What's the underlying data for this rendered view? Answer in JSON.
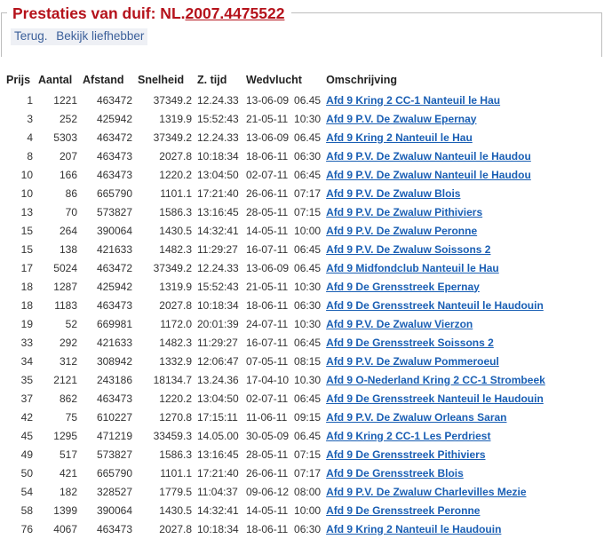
{
  "header": {
    "title_prefix": "Prestaties van duif: NL.",
    "title_number": "2007.4475522"
  },
  "nav": {
    "back_label": "Terug.",
    "owner_label": "Bekijk liefhebber"
  },
  "table": {
    "columns": [
      "Prijs",
      "Aantal",
      "Afstand",
      "Snelheid",
      "Z. tijd",
      "Wedvlucht",
      "Omschrijving"
    ],
    "rows": [
      {
        "prijs": "1",
        "aantal": "1221",
        "afstand": "463472",
        "snelheid": "37349.2",
        "ztijd": "12.24.33",
        "datum": "13-06-09",
        "tijd": "06.45",
        "oms": "Afd 9 Kring 2 CC-1 Nanteuil le Hau"
      },
      {
        "prijs": "3",
        "aantal": "252",
        "afstand": "425942",
        "snelheid": "1319.9",
        "ztijd": "15:52:43",
        "datum": "21-05-11",
        "tijd": "10:30",
        "oms": "Afd 9 P.V. De Zwaluw Epernay"
      },
      {
        "prijs": "4",
        "aantal": "5303",
        "afstand": "463472",
        "snelheid": "37349.2",
        "ztijd": "12.24.33",
        "datum": "13-06-09",
        "tijd": "06.45",
        "oms": "Afd 9 Kring 2 Nanteuil le Hau"
      },
      {
        "prijs": "8",
        "aantal": "207",
        "afstand": "463473",
        "snelheid": "2027.8",
        "ztijd": "10:18:34",
        "datum": "18-06-11",
        "tijd": "06:30",
        "oms": "Afd 9 P.V. De Zwaluw Nanteuil le Haudou"
      },
      {
        "prijs": "10",
        "aantal": "166",
        "afstand": "463473",
        "snelheid": "1220.2",
        "ztijd": "13:04:50",
        "datum": "02-07-11",
        "tijd": "06:45",
        "oms": "Afd 9 P.V. De Zwaluw Nanteuil le Haudou"
      },
      {
        "prijs": "10",
        "aantal": "86",
        "afstand": "665790",
        "snelheid": "1101.1",
        "ztijd": "17:21:40",
        "datum": "26-06-11",
        "tijd": "07:17",
        "oms": "Afd 9 P.V. De Zwaluw Blois"
      },
      {
        "prijs": "13",
        "aantal": "70",
        "afstand": "573827",
        "snelheid": "1586.3",
        "ztijd": "13:16:45",
        "datum": "28-05-11",
        "tijd": "07:15",
        "oms": "Afd 9 P.V. De Zwaluw Pithiviers"
      },
      {
        "prijs": "15",
        "aantal": "264",
        "afstand": "390064",
        "snelheid": "1430.5",
        "ztijd": "14:32:41",
        "datum": "14-05-11",
        "tijd": "10:00",
        "oms": "Afd 9 P.V. De Zwaluw Peronne"
      },
      {
        "prijs": "15",
        "aantal": "138",
        "afstand": "421633",
        "snelheid": "1482.3",
        "ztijd": "11:29:27",
        "datum": "16-07-11",
        "tijd": "06:45",
        "oms": "Afd 9 P.V. De Zwaluw Soissons 2"
      },
      {
        "prijs": "17",
        "aantal": "5024",
        "afstand": "463472",
        "snelheid": "37349.2",
        "ztijd": "12.24.33",
        "datum": "13-06-09",
        "tijd": "06.45",
        "oms": "Afd 9 Midfondclub Nanteuil le Hau"
      },
      {
        "prijs": "18",
        "aantal": "1287",
        "afstand": "425942",
        "snelheid": "1319.9",
        "ztijd": "15:52:43",
        "datum": "21-05-11",
        "tijd": "10:30",
        "oms": "Afd 9 De Grensstreek Epernay"
      },
      {
        "prijs": "18",
        "aantal": "1183",
        "afstand": "463473",
        "snelheid": "2027.8",
        "ztijd": "10:18:34",
        "datum": "18-06-11",
        "tijd": "06:30",
        "oms": "Afd 9 De Grensstreek Nanteuil le Haudouin"
      },
      {
        "prijs": "19",
        "aantal": "52",
        "afstand": "669981",
        "snelheid": "1172.0",
        "ztijd": "20:01:39",
        "datum": "24-07-11",
        "tijd": "10:30",
        "oms": "Afd 9 P.V. De Zwaluw Vierzon"
      },
      {
        "prijs": "33",
        "aantal": "292",
        "afstand": "421633",
        "snelheid": "1482.3",
        "ztijd": "11:29:27",
        "datum": "16-07-11",
        "tijd": "06:45",
        "oms": "Afd 9 De Grensstreek Soissons 2"
      },
      {
        "prijs": "34",
        "aantal": "312",
        "afstand": "308942",
        "snelheid": "1332.9",
        "ztijd": "12:06:47",
        "datum": "07-05-11",
        "tijd": "08:15",
        "oms": "Afd 9 P.V. De Zwaluw Pommeroeul"
      },
      {
        "prijs": "35",
        "aantal": "2121",
        "afstand": "243186",
        "snelheid": "18134.7",
        "ztijd": "13.24.36",
        "datum": "17-04-10",
        "tijd": "10.30",
        "oms": "Afd 9 O-Nederland Kring 2 CC-1 Strombeek"
      },
      {
        "prijs": "37",
        "aantal": "862",
        "afstand": "463473",
        "snelheid": "1220.2",
        "ztijd": "13:04:50",
        "datum": "02-07-11",
        "tijd": "06:45",
        "oms": "Afd 9 De Grensstreek Nanteuil le Haudouin"
      },
      {
        "prijs": "42",
        "aantal": "75",
        "afstand": "610227",
        "snelheid": "1270.8",
        "ztijd": "17:15:11",
        "datum": "11-06-11",
        "tijd": "09:15",
        "oms": "Afd 9 P.V. De Zwaluw Orleans Saran"
      },
      {
        "prijs": "45",
        "aantal": "1295",
        "afstand": "471219",
        "snelheid": "33459.3",
        "ztijd": "14.05.00",
        "datum": "30-05-09",
        "tijd": "06.45",
        "oms": "Afd 9 Kring 2 CC-1 Les Perdriest"
      },
      {
        "prijs": "49",
        "aantal": "517",
        "afstand": "573827",
        "snelheid": "1586.3",
        "ztijd": "13:16:45",
        "datum": "28-05-11",
        "tijd": "07:15",
        "oms": "Afd 9 De Grensstreek Pithiviers"
      },
      {
        "prijs": "50",
        "aantal": "421",
        "afstand": "665790",
        "snelheid": "1101.1",
        "ztijd": "17:21:40",
        "datum": "26-06-11",
        "tijd": "07:17",
        "oms": "Afd 9 De Grensstreek Blois"
      },
      {
        "prijs": "54",
        "aantal": "182",
        "afstand": "328527",
        "snelheid": "1779.5",
        "ztijd": "11:04:37",
        "datum": "09-06-12",
        "tijd": "08:00",
        "oms": "Afd 9 P.V. De Zwaluw Charlevilles Mezie"
      },
      {
        "prijs": "58",
        "aantal": "1399",
        "afstand": "390064",
        "snelheid": "1430.5",
        "ztijd": "14:32:41",
        "datum": "14-05-11",
        "tijd": "10:00",
        "oms": "Afd 9 De Grensstreek Peronne"
      },
      {
        "prijs": "76",
        "aantal": "4067",
        "afstand": "463473",
        "snelheid": "2027.8",
        "ztijd": "10:18:34",
        "datum": "18-06-11",
        "tijd": "06:30",
        "oms": "Afd 9 Kring 2 Nanteuil le Haudouin"
      }
    ]
  }
}
